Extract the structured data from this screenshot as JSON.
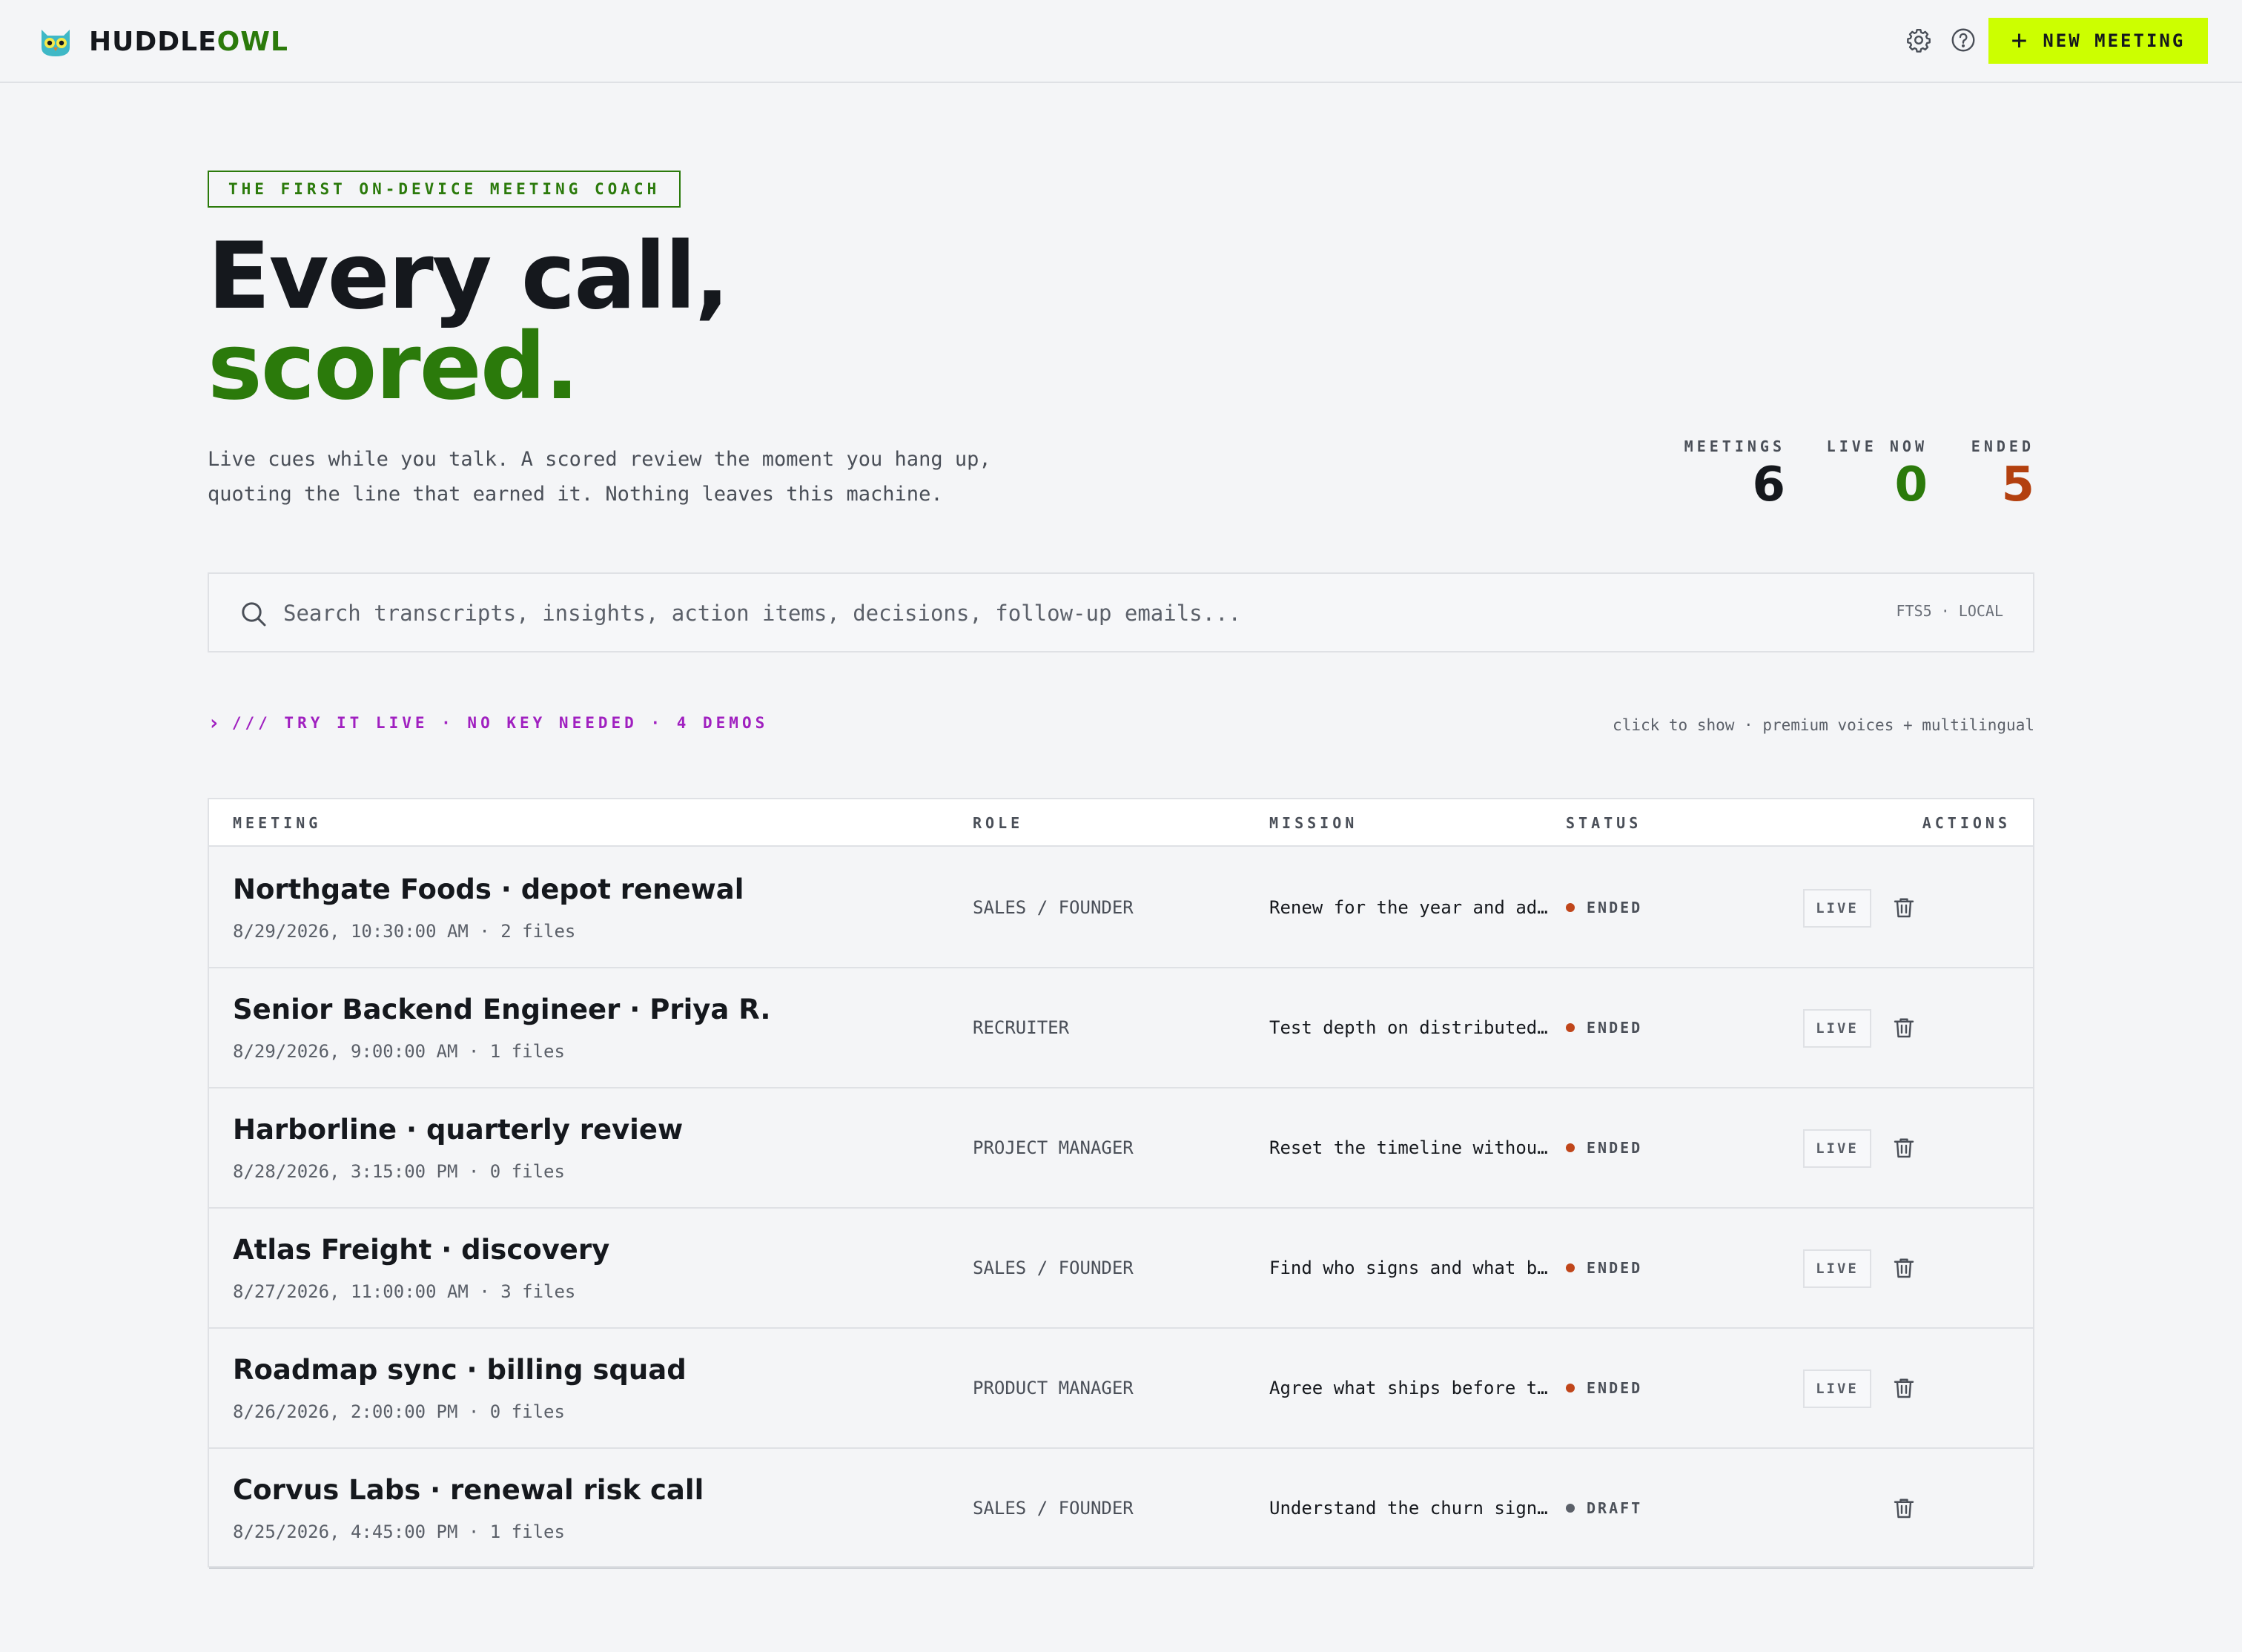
{
  "brand": {
    "name_a": "HUDDLE",
    "name_b": "OWL",
    "logo_icon": "owl-logo-icon"
  },
  "header": {
    "settings_icon": "gear-icon",
    "help_icon": "help-icon",
    "new_meeting_label": "NEW MEETING",
    "accent_color": "#ccff00"
  },
  "hero": {
    "badge": "THE FIRST ON-DEVICE MEETING COACH",
    "title_line1": "Every call,",
    "title_line2": "scored.",
    "subtitle_line1": "Live cues while you talk. A scored review the moment you hang up,",
    "subtitle_line2": "quoting the line that earned it. Nothing leaves this machine."
  },
  "stats": [
    {
      "label": "MEETINGS",
      "value": "6",
      "color": "#15181d"
    },
    {
      "label": "LIVE NOW",
      "value": "0",
      "color": "#2b7a0b"
    },
    {
      "label": "ENDED",
      "value": "5",
      "color": "#b3400f"
    }
  ],
  "search": {
    "placeholder": "Search transcripts, insights, action items, decisions, follow-up emails...",
    "value": "",
    "tag": "FTS5 · LOCAL"
  },
  "demos": {
    "label": "/// TRY IT LIVE · NO KEY NEEDED · 4 DEMOS",
    "hint": "click to show · premium voices + multilingual"
  },
  "table": {
    "columns": {
      "meeting": "MEETING",
      "role": "ROLE",
      "mission": "MISSION",
      "status": "STATUS",
      "actions": "ACTIONS"
    },
    "live_label": "LIVE",
    "rows": [
      {
        "title": "Northgate Foods · depot renewal",
        "meta": "8/29/2026, 10:30:00 AM · 2 files",
        "role": "SALES / FOUNDER",
        "mission": "Renew for the year and ad…",
        "status": "ENDED",
        "status_color": "#c0461b",
        "live": true
      },
      {
        "title": "Senior Backend Engineer · Priya R.",
        "meta": "8/29/2026, 9:00:00 AM · 1 files",
        "role": "RECRUITER",
        "mission": "Test depth on distributed…",
        "status": "ENDED",
        "status_color": "#c0461b",
        "live": true
      },
      {
        "title": "Harborline · quarterly review",
        "meta": "8/28/2026, 3:15:00 PM · 0 files",
        "role": "PROJECT MANAGER",
        "mission": "Reset the timeline withou…",
        "status": "ENDED",
        "status_color": "#c0461b",
        "live": true
      },
      {
        "title": "Atlas Freight · discovery",
        "meta": "8/27/2026, 11:00:00 AM · 3 files",
        "role": "SALES / FOUNDER",
        "mission": "Find who signs and what b…",
        "status": "ENDED",
        "status_color": "#c0461b",
        "live": true
      },
      {
        "title": "Roadmap sync · billing squad",
        "meta": "8/26/2026, 2:00:00 PM · 0 files",
        "role": "PRODUCT MANAGER",
        "mission": "Agree what ships before t…",
        "status": "ENDED",
        "status_color": "#c0461b",
        "live": true
      },
      {
        "title": "Corvus Labs · renewal risk call",
        "meta": "8/25/2026, 4:45:00 PM · 1 files",
        "role": "SALES / FOUNDER",
        "mission": "Understand the churn sign…",
        "status": "DRAFT",
        "status_color": "#5b6069",
        "live": false
      }
    ]
  }
}
